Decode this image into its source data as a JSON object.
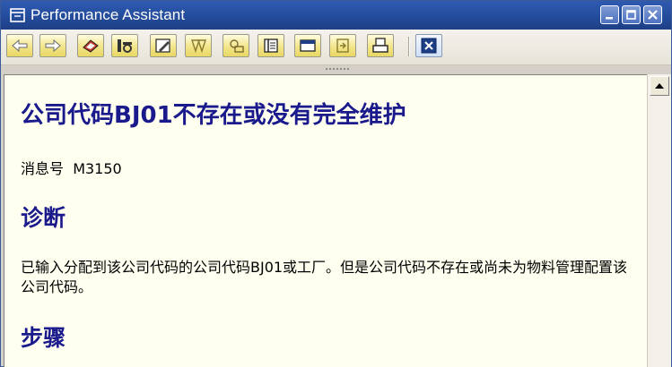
{
  "window": {
    "title": "Performance Assistant"
  },
  "toolbar": {
    "buttons": [
      {
        "icon": "back-arrow-icon"
      },
      {
        "icon": "forward-arrow-icon"
      },
      {
        "icon": "eraser-icon"
      },
      {
        "icon": "technical-info-icon"
      },
      {
        "icon": "edit-note-icon"
      },
      {
        "icon": "notes-icon"
      },
      {
        "icon": "settings-icon"
      },
      {
        "icon": "table-of-contents-icon"
      },
      {
        "icon": "window-icon"
      },
      {
        "icon": "export-icon"
      },
      {
        "icon": "print-icon"
      },
      {
        "icon": "exit-icon"
      }
    ]
  },
  "document": {
    "title": "公司代码BJ01不存在或没有完全维护",
    "message_label": "消息号",
    "message_number": "M3150",
    "diagnosis_heading": "诊断",
    "diagnosis_text": "已输入分配到该公司代码的公司代码BJ01或工厂。但是公司代码不存在或尚未为物料管理配置该公司代码。",
    "procedure_heading": "步骤"
  },
  "colors": {
    "titlebar": "#264fa0",
    "heading": "#1a1a8c",
    "content_bg": "#fffff0",
    "toolbar_button": "#f2e58a"
  }
}
